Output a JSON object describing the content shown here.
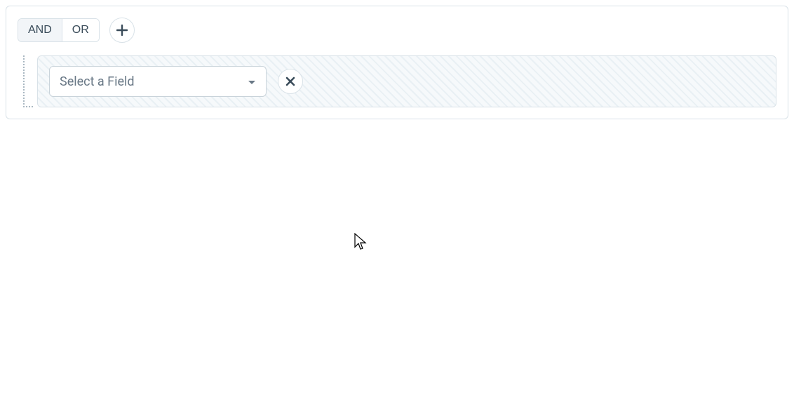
{
  "logic_toggle": {
    "and": "AND",
    "or": "OR",
    "selected": "AND"
  },
  "field_select": {
    "placeholder": "Select a Field"
  }
}
